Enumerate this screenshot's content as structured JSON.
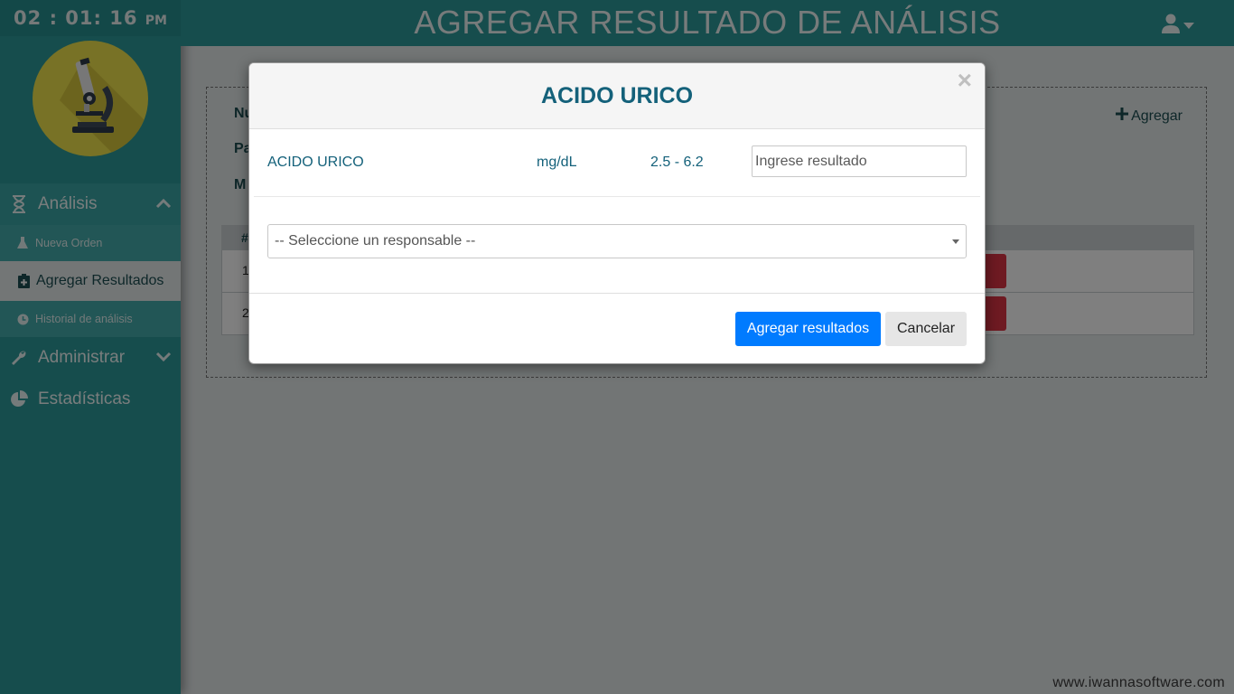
{
  "clock": {
    "time": "02 : 01: 16",
    "ampm": "PM"
  },
  "header": {
    "title": "AGREGAR RESULTADO DE ANÁLISIS"
  },
  "sidebar": {
    "analisis": {
      "label": "Análisis",
      "icon": "hourglass-icon"
    },
    "items": [
      {
        "label": "Nueva Orden",
        "icon": "flask-icon"
      },
      {
        "label": "Agregar Resultados",
        "icon": "clipboard-plus-icon",
        "active": true
      },
      {
        "label": "Historial de análisis",
        "icon": "clock-icon"
      }
    ],
    "administrar": {
      "label": "Administrar",
      "icon": "wrench-icon"
    },
    "estadisticas": {
      "label": "Estadísticas",
      "icon": "pie-chart-icon"
    }
  },
  "background": {
    "field_labels": [
      "Nu",
      "Pa",
      "M"
    ],
    "add_link": "Agregar",
    "table_header": "#",
    "rows": [
      "1",
      "2"
    ]
  },
  "modal": {
    "title": "ACIDO URICO",
    "close": "×",
    "result": {
      "name": "ACIDO URICO",
      "unit": "mg/dL",
      "range": "2.5 - 6.2",
      "placeholder": "Ingrese resultado"
    },
    "responsable_placeholder": "-- Seleccione un responsable --",
    "submit_label": "Agregar resultados",
    "cancel_label": "Cancelar"
  },
  "watermark": "www.iwannasoftware.com",
  "colors": {
    "primary": "#007bff",
    "teal": "#2c9a9a",
    "title": "#14617a",
    "danger": "#dc3545"
  }
}
